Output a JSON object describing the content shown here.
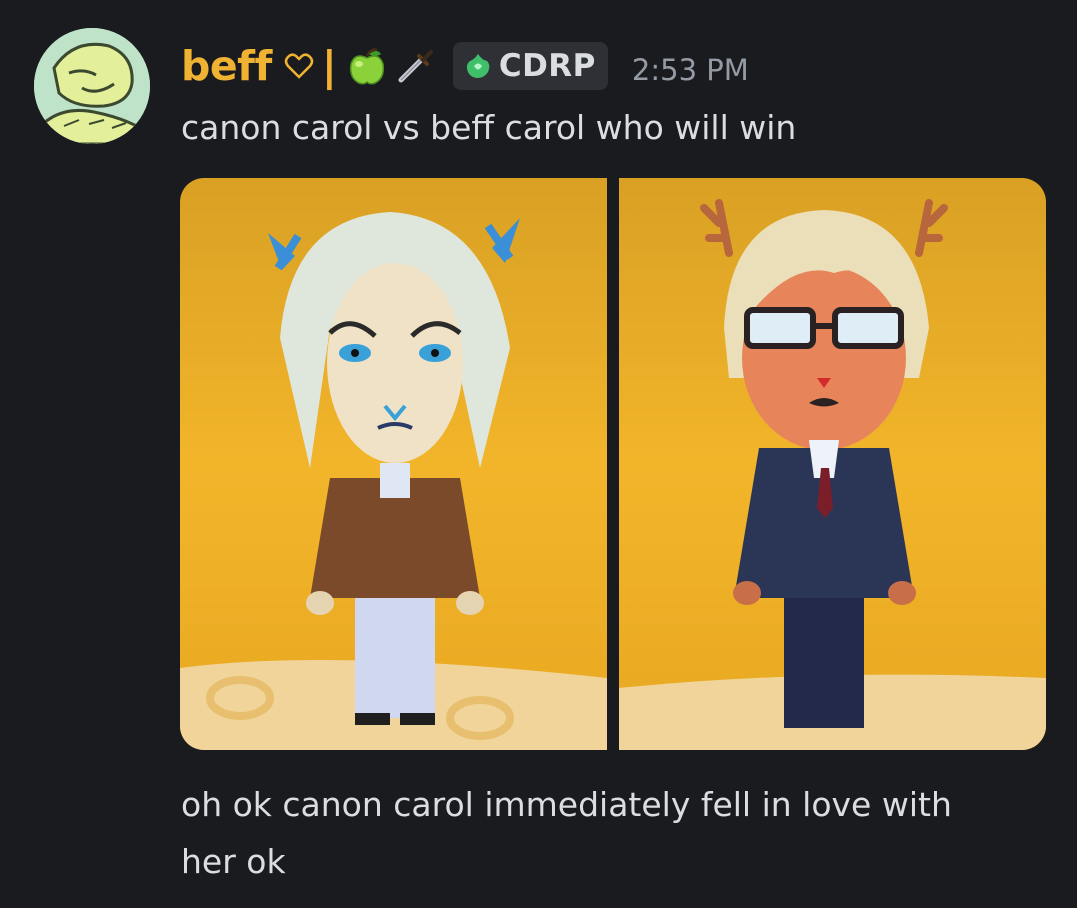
{
  "author": {
    "name": "beff",
    "separator": "|",
    "name_color": "#f0b232",
    "avatar_icon": "green-creature-avatar",
    "heart_icon": "heart-outline-icon",
    "emojis": [
      "green-apple-emoji",
      "dagger-emoji"
    ],
    "server_tag": {
      "label": "CDRP",
      "icon": "green-gem-icon"
    }
  },
  "timestamp": "2:53 PM",
  "message": {
    "text": "canon carol vs beff carol who will win"
  },
  "attachments": [
    {
      "name": "mii-canon-carol",
      "bg": "#f2b52a"
    },
    {
      "name": "mii-beff-carol",
      "bg": "#f2b52a"
    }
  ],
  "followup": {
    "line1": "oh ok canon carol immediately fell in love with",
    "line2": "her ok"
  }
}
